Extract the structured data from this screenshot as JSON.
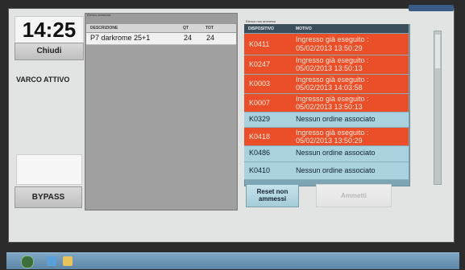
{
  "clock": "14:25",
  "left": {
    "chiudi_label": "Chiudi",
    "status": "VARCO ATTIVO",
    "bypass_label": "BYPASS"
  },
  "admitted": {
    "caption": "Elenco ammessi",
    "headers": [
      "DESCRIZIONE",
      "QT",
      "TOT"
    ],
    "rows": [
      {
        "descrizione": "P7 darkrome 25+1",
        "qt": "24",
        "tot": "24"
      }
    ]
  },
  "not_admitted": {
    "caption": "Elenco non ammessi",
    "headers": [
      "DISPOSITIVO",
      "MOTIVO"
    ],
    "rows": [
      {
        "code": "K0411",
        "msg1": "Ingresso già eseguito :",
        "msg2": "05/02/2013 13:50:29",
        "status": "red"
      },
      {
        "code": "K0247",
        "msg1": "Ingresso già eseguito :",
        "msg2": "05/02/2013 13:50:13",
        "status": "red"
      },
      {
        "code": "K0003",
        "msg1": "Ingresso già eseguito :",
        "msg2": "05/02/2013 14:03:58",
        "status": "red"
      },
      {
        "code": "K0007",
        "msg1": "Ingresso già eseguito :",
        "msg2": "05/02/2013 13:50:13",
        "status": "red"
      },
      {
        "code": "K0329",
        "msg1": "Nessun ordine associato",
        "msg2": "",
        "status": "blue"
      },
      {
        "code": "K0418",
        "msg1": "Ingresso già eseguito :",
        "msg2": "05/02/2013 13:50:29",
        "status": "red"
      },
      {
        "code": "K0486",
        "msg1": "Nessun ordine associato",
        "msg2": "",
        "status": "blue"
      },
      {
        "code": "K0410",
        "msg1": "Nessun ordine associato",
        "msg2": "",
        "status": "blue"
      }
    ]
  },
  "actions": {
    "reset_line1": "Reset non",
    "reset_line2": "ammessi",
    "ammetti_label": "Ammetti"
  },
  "colors": {
    "red_row": "#eb4f2a",
    "blue_row": "#a9d2de"
  },
  "icons": [
    "start-orb-icon",
    "internet-explorer-icon",
    "folder-icon"
  ]
}
